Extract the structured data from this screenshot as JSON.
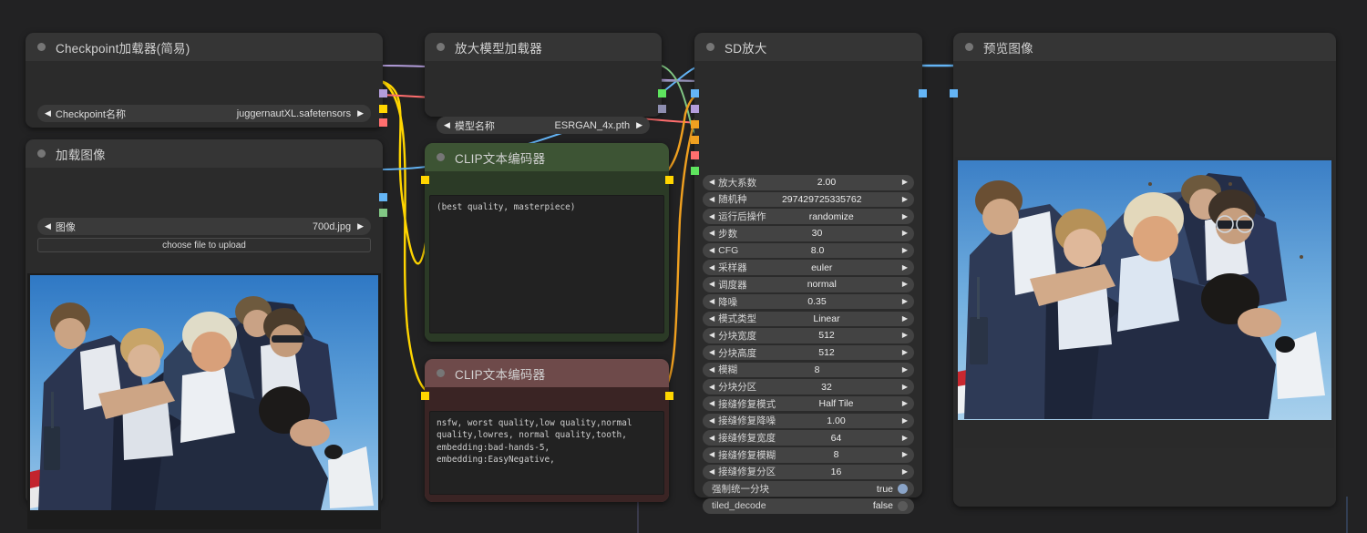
{
  "canvas": {
    "bg": "#222223"
  },
  "nodes": {
    "checkpoint_loader": {
      "title": "Checkpoint加载器(简易)",
      "widget_label": "Checkpoint名称",
      "widget_value": "juggernautXL.safetensors",
      "outputs": [
        {
          "name": "MODEL",
          "color": "#b39ddb"
        },
        {
          "name": "CLIP",
          "color": "#ffd500"
        },
        {
          "name": "VAE",
          "color": "#ff6e6e"
        }
      ]
    },
    "load_image": {
      "title": "加载图像",
      "widget_label": "图像",
      "widget_value": "700d.jpg",
      "upload_label": "choose file to upload",
      "outputs": [
        {
          "name": "IMAGE",
          "color": "#64b5f6"
        },
        {
          "name": "MASK",
          "color": "#81c784"
        }
      ]
    },
    "upscale_model_loader": {
      "title": "放大模型加载器",
      "widget_label": "模型名称",
      "widget_value": "ESRGAN_4x.pth",
      "outputs": [
        {
          "name": "UPSCALE_MODEL",
          "color": "#5ee45e"
        },
        {
          "name": "slot2",
          "color": "#8e8eb0"
        }
      ]
    },
    "clip_positive": {
      "title": "CLIP文本编码器",
      "text": "(best quality, masterpiece)",
      "header_color": "#3d5434",
      "body_color": "#2b3a26",
      "input": {
        "name": "clip",
        "color": "#ffd500"
      },
      "output": {
        "name": "CONDITIONING",
        "color": "#ffd500"
      }
    },
    "clip_negative": {
      "title": "CLIP文本编码器",
      "text": "nsfw, worst quality,low quality,normal quality,lowres, normal quality,tooth, embedding:bad-hands-5, embedding:EasyNegative,",
      "header_color": "#6e4a4a",
      "body_color": "#3a2424",
      "input": {
        "name": "clip",
        "color": "#ffd500"
      },
      "output": {
        "name": "CONDITIONING",
        "color": "#ffd500"
      }
    },
    "sd_upscale": {
      "title": "SD放大",
      "inputs": [
        {
          "name": "image",
          "color": "#64b5f6"
        },
        {
          "name": "model",
          "color": "#b39ddb"
        },
        {
          "name": "positive",
          "color": "#f0a020"
        },
        {
          "name": "negative",
          "color": "#f0a020"
        },
        {
          "name": "vae",
          "color": "#ff6e6e"
        },
        {
          "name": "upscale_model",
          "color": "#5ee45e"
        }
      ],
      "outputs": [
        {
          "name": "IMAGE",
          "color": "#64b5f6"
        }
      ],
      "widgets": [
        {
          "label": "放大系数",
          "value": "2.00",
          "type": "number"
        },
        {
          "label": "随机种",
          "value": "297429725335762",
          "type": "number"
        },
        {
          "label": "运行后操作",
          "value": "randomize",
          "type": "combo"
        },
        {
          "label": "步数",
          "value": "30",
          "type": "number"
        },
        {
          "label": "CFG",
          "value": "8.0",
          "type": "number"
        },
        {
          "label": "采样器",
          "value": "euler",
          "type": "combo"
        },
        {
          "label": "调度器",
          "value": "normal",
          "type": "combo"
        },
        {
          "label": "降噪",
          "value": "0.35",
          "type": "number"
        },
        {
          "label": "模式类型",
          "value": "Linear",
          "type": "combo"
        },
        {
          "label": "分块宽度",
          "value": "512",
          "type": "number"
        },
        {
          "label": "分块高度",
          "value": "512",
          "type": "number"
        },
        {
          "label": "模糊",
          "value": "8",
          "type": "number"
        },
        {
          "label": "分块分区",
          "value": "32",
          "type": "number"
        },
        {
          "label": "接缝修复模式",
          "value": "Half Tile",
          "type": "combo"
        },
        {
          "label": "接缝修复降噪",
          "value": "1.00",
          "type": "number"
        },
        {
          "label": "接缝修复宽度",
          "value": "64",
          "type": "number"
        },
        {
          "label": "接缝修复模糊",
          "value": "8",
          "type": "number"
        },
        {
          "label": "接缝修复分区",
          "value": "16",
          "type": "number"
        },
        {
          "label": "强制统一分块",
          "value": "true",
          "type": "toggle_on"
        },
        {
          "label": "tiled_decode",
          "value": "false",
          "type": "toggle_off"
        }
      ]
    },
    "preview_image": {
      "title": "预览图像",
      "input": {
        "name": "images",
        "color": "#64b5f6"
      }
    }
  },
  "icons": {
    "arrow_left": "◀",
    "arrow_right": "▶"
  }
}
